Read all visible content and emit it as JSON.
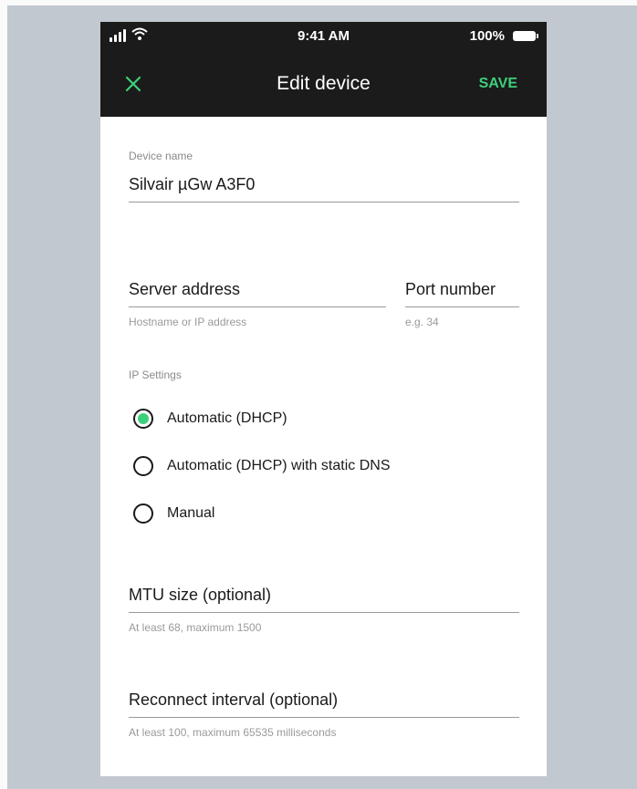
{
  "status_bar": {
    "time": "9:41 AM",
    "battery": "100%"
  },
  "header": {
    "title": "Edit device",
    "save_label": "SAVE"
  },
  "device_name": {
    "label": "Device name",
    "value": "Silvair µGw A3F0"
  },
  "server_address": {
    "placeholder": "Server address",
    "helper": "Hostname or IP address"
  },
  "port_number": {
    "placeholder": "Port number",
    "helper": "e.g. 34"
  },
  "ip_settings": {
    "label": "IP Settings",
    "options": [
      {
        "label": "Automatic (DHCP)",
        "selected": true
      },
      {
        "label": "Automatic (DHCP) with static DNS",
        "selected": false
      },
      {
        "label": "Manual",
        "selected": false
      }
    ]
  },
  "mtu": {
    "placeholder": "MTU size (optional)",
    "helper": "At least 68, maximum 1500"
  },
  "reconnect": {
    "placeholder": "Reconnect interval (optional)",
    "helper": "At least 100, maximum 65535 milliseconds"
  },
  "colors": {
    "accent": "#3ecf7a",
    "header_bg": "#1b1b1b",
    "backdrop": "#c2c8cf"
  }
}
